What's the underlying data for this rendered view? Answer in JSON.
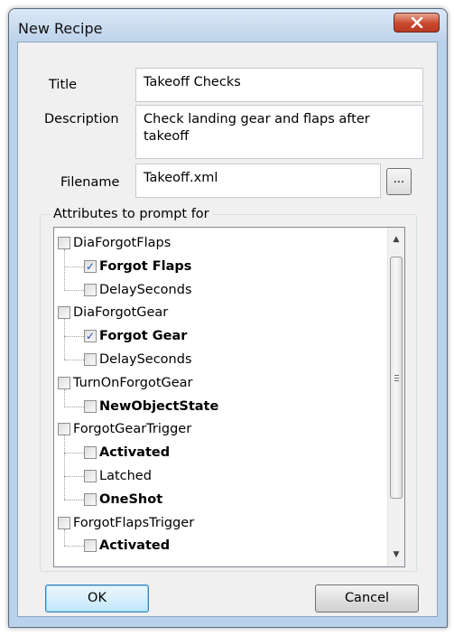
{
  "window": {
    "title": "New Recipe"
  },
  "form": {
    "title_label": "Title",
    "title_value": "Takeoff Checks",
    "description_label": "Description",
    "description_value": "Check landing gear and flaps after takeoff",
    "filename_label": "Filename",
    "filename_value": "Takeoff.xml",
    "browse_label": "..."
  },
  "attributes": {
    "group_label": "Attributes to prompt for",
    "tree": [
      {
        "label": "DiaForgotFlaps",
        "level": 0,
        "checked": false,
        "bold": false
      },
      {
        "label": "Forgot Flaps",
        "level": 1,
        "checked": true,
        "bold": true
      },
      {
        "label": "DelaySeconds",
        "level": 1,
        "checked": false,
        "bold": false
      },
      {
        "label": "DiaForgotGear",
        "level": 0,
        "checked": false,
        "bold": false
      },
      {
        "label": "Forgot Gear",
        "level": 1,
        "checked": true,
        "bold": true
      },
      {
        "label": "DelaySeconds",
        "level": 1,
        "checked": false,
        "bold": false
      },
      {
        "label": "TurnOnForgotGear",
        "level": 0,
        "checked": false,
        "bold": false
      },
      {
        "label": "NewObjectState",
        "level": 1,
        "checked": false,
        "bold": true
      },
      {
        "label": "ForgotGearTrigger",
        "level": 0,
        "checked": false,
        "bold": false
      },
      {
        "label": "Activated",
        "level": 1,
        "checked": false,
        "bold": true
      },
      {
        "label": "Latched",
        "level": 1,
        "checked": false,
        "bold": false
      },
      {
        "label": "OneShot",
        "level": 1,
        "checked": false,
        "bold": true
      },
      {
        "label": "ForgotFlapsTrigger",
        "level": 0,
        "checked": false,
        "bold": false
      },
      {
        "label": "Activated",
        "level": 1,
        "checked": false,
        "bold": true
      }
    ]
  },
  "buttons": {
    "ok": "OK",
    "cancel": "Cancel"
  },
  "icons": {
    "close": "close-x-icon",
    "scroll_up": "scroll-up-arrow-icon",
    "scroll_down": "scroll-down-arrow-icon"
  }
}
